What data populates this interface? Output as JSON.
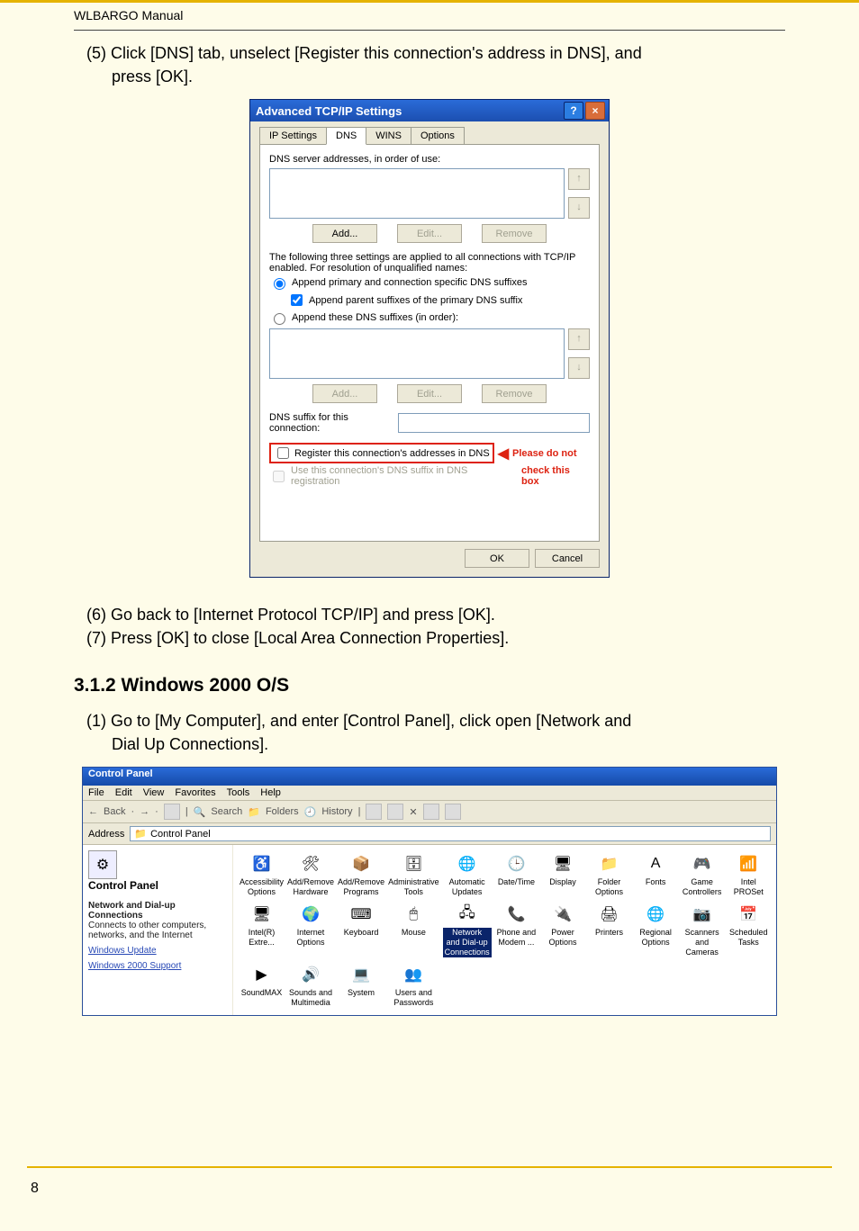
{
  "doc": {
    "header": "WLBARGO Manual",
    "page_number": "8"
  },
  "steps": {
    "s5_a": "(5) Click [DNS] tab, unselect [Register this connection's address in DNS], and",
    "s5_b": "press [OK].",
    "s6": "(6) Go back to [Internet Protocol TCP/IP] and press [OK].",
    "s7": "(7) Press [OK] to close [Local Area Connection Properties].",
    "section": "3.1.2 Windows 2000 O/S",
    "w1_a": "(1) Go to [My Computer], and enter [Control Panel], click open [Network and",
    "w1_b": "Dial Up Connections]."
  },
  "dialog": {
    "title": "Advanced TCP/IP Settings",
    "tabs": {
      "ip": "IP Settings",
      "dns": "DNS",
      "wins": "WINS",
      "options": "Options"
    },
    "dns_addr_label": "DNS server addresses, in order of use:",
    "btn_add": "Add...",
    "btn_edit": "Edit...",
    "btn_remove": "Remove",
    "three_settings_a": "The following three settings are applied to all connections with TCP/IP",
    "three_settings_b": "enabled. For resolution of unqualified names:",
    "radio_primary": "Append primary and connection specific DNS suffixes",
    "check_parent": "Append parent suffixes of the primary DNS suffix",
    "radio_these": "Append these DNS suffixes (in order):",
    "suffix_label": "DNS suffix for this connection:",
    "register_check": "Register this connection's addresses in DNS",
    "use_suffix_check": "Use this connection's DNS suffix in DNS registration",
    "annot_top": "Please do not",
    "annot_bottom": "check this box",
    "ok": "OK",
    "cancel": "Cancel"
  },
  "cp": {
    "title": "Control Panel",
    "menu": [
      "File",
      "Edit",
      "View",
      "Favorites",
      "Tools",
      "Help"
    ],
    "toolbar": {
      "back": "Back",
      "search": "Search",
      "folders": "Folders",
      "history": "History"
    },
    "address_label": "Address",
    "address_value": "Control Panel",
    "left": {
      "title": "Control Panel",
      "sub_bold": "Network and Dial-up Connections",
      "sub_desc": "Connects to other computers, networks, and the Internet",
      "link1": "Windows Update",
      "link2": "Windows 2000 Support"
    },
    "items": [
      {
        "label": "Accessibility Options",
        "icon": "♿"
      },
      {
        "label": "Add/Remove Hardware",
        "icon": "🛠"
      },
      {
        "label": "Add/Remove Programs",
        "icon": "📦"
      },
      {
        "label": "Administrative Tools",
        "icon": "🗄"
      },
      {
        "label": "Automatic Updates",
        "icon": "🌐"
      },
      {
        "label": "Date/Time",
        "icon": "🕒"
      },
      {
        "label": "Display",
        "icon": "🖥"
      },
      {
        "label": "Folder Options",
        "icon": "📁"
      },
      {
        "label": "Fonts",
        "icon": "A"
      },
      {
        "label": "Game Controllers",
        "icon": "🎮"
      },
      {
        "label": "Intel PROSet",
        "icon": "📶"
      },
      {
        "label": "Intel(R) Extre...",
        "icon": "🖥"
      },
      {
        "label": "Internet Options",
        "icon": "🌍"
      },
      {
        "label": "Keyboard",
        "icon": "⌨"
      },
      {
        "label": "Mouse",
        "icon": "🖱"
      },
      {
        "label": "Network and Dial-up Connections",
        "icon": "🖧",
        "selected": true
      },
      {
        "label": "Phone and Modem ...",
        "icon": "📞"
      },
      {
        "label": "Power Options",
        "icon": "🔌"
      },
      {
        "label": "Printers",
        "icon": "🖨"
      },
      {
        "label": "Regional Options",
        "icon": "🌐"
      },
      {
        "label": "Scanners and Cameras",
        "icon": "📷"
      },
      {
        "label": "Scheduled Tasks",
        "icon": "📅"
      },
      {
        "label": "SoundMAX",
        "icon": "▶"
      },
      {
        "label": "Sounds and Multimedia",
        "icon": "🔊"
      },
      {
        "label": "System",
        "icon": "💻"
      },
      {
        "label": "Users and Passwords",
        "icon": "👥"
      }
    ]
  }
}
